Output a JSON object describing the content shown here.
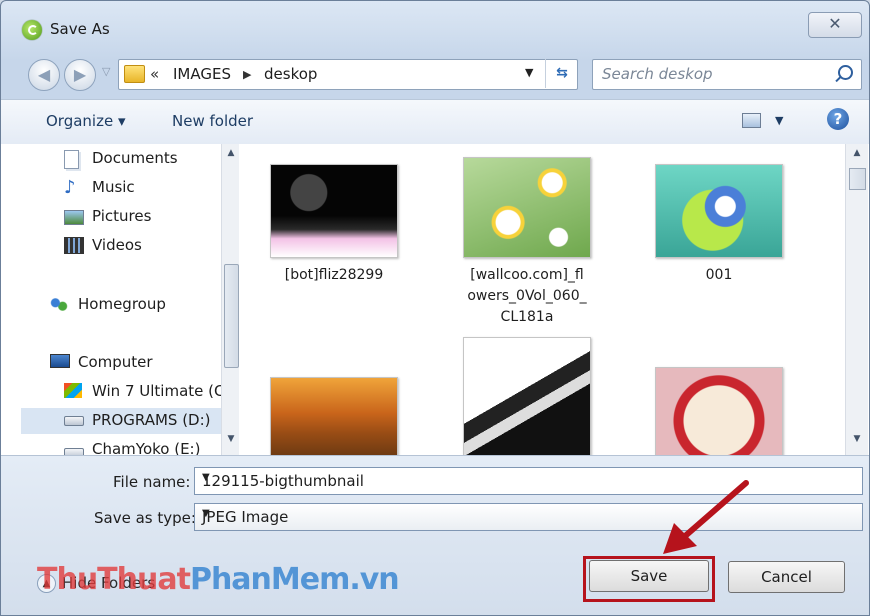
{
  "window": {
    "title": "Save As",
    "close_label": "✕"
  },
  "nav": {
    "back_label": "◀",
    "forward_label": "▶",
    "breadcrumb_overflow": "«",
    "breadcrumb": [
      "IMAGES",
      "deskop"
    ],
    "search_placeholder": "Search deskop"
  },
  "toolbar": {
    "organize": "Organize ▾",
    "new_folder": "New folder",
    "view_dropdown": "▼",
    "help": "?"
  },
  "sidebar": {
    "items": [
      {
        "label": "Documents",
        "icon": "documents-icon"
      },
      {
        "label": "Music",
        "icon": "music-icon"
      },
      {
        "label": "Pictures",
        "icon": "pictures-icon"
      },
      {
        "label": "Videos",
        "icon": "videos-icon"
      },
      {
        "label": "Homegroup",
        "icon": "homegroup-icon"
      },
      {
        "label": "Computer",
        "icon": "computer-icon"
      },
      {
        "label": "Win 7 Ultimate (C",
        "icon": "drive-c-icon"
      },
      {
        "label": "PROGRAMS (D:)",
        "icon": "drive-icon",
        "selected": true
      },
      {
        "label": "ChamYoko (E:)",
        "icon": "drive-icon"
      }
    ]
  },
  "files": [
    {
      "name": "[bot]fliz28299"
    },
    {
      "name": "[wallcoo.com]_flowers_0Vol_060_CL181a",
      "lines": [
        "[wallcoo.com]_fl",
        "owers_0Vol_060_",
        "CL181a"
      ]
    },
    {
      "name": "001"
    },
    {
      "name": ""
    },
    {
      "name": ""
    },
    {
      "name": ""
    }
  ],
  "footer": {
    "file_name_label": "File name:",
    "file_name_value": "129115-bigthumbnail",
    "save_type_label": "Save as type:",
    "save_type_value": "JPEG Image",
    "hide_folders": "Hide Folders",
    "save_button": "Save",
    "cancel_button": "Cancel"
  },
  "watermark": {
    "part1": "ThuThuat",
    "part2": "PhanMem.vn"
  },
  "colors": {
    "highlight": "#b6131c",
    "accent": "#2e5f9e"
  }
}
